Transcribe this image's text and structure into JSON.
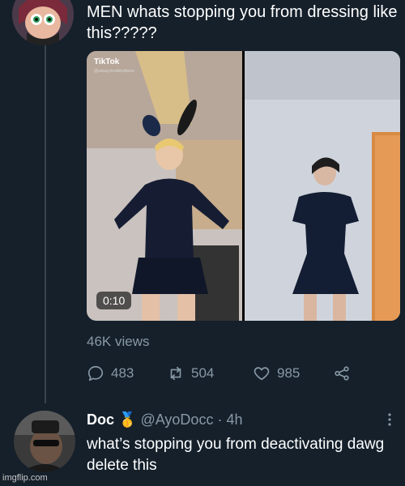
{
  "tweet1": {
    "text": "MEN whats stopping you from dressing like this?????",
    "media": {
      "brand": "TikTok",
      "handle": "@umazymodelsdbonn",
      "duration": "0:10"
    },
    "views": "46K views",
    "actions": {
      "replies": "483",
      "retweets": "504",
      "likes": "985"
    }
  },
  "tweet2": {
    "name": "Doc",
    "badge": "🥇",
    "handle": "@AyoDocc",
    "separator": "·",
    "time": "4h",
    "text": "what’s stopping you from deactivating dawg delete this"
  },
  "watermark": "imgflip.com",
  "colors": {
    "background": "#15202b",
    "muted": "#8899a6",
    "line": "#38444d",
    "text": "#ffffff"
  }
}
